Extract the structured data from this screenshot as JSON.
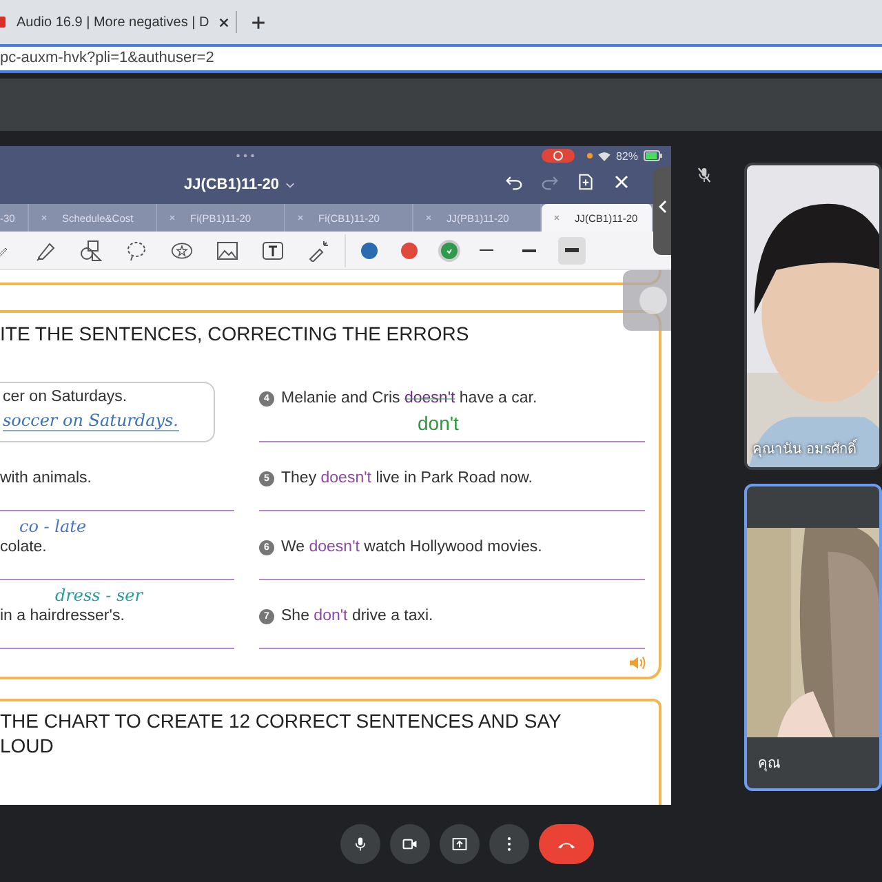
{
  "browser": {
    "tab": {
      "title": "Audio 16.9 | More negatives | D"
    },
    "address": "pc-auxm-hvk?pli=1&authuser=2"
  },
  "shared_screen": {
    "battery": "82%",
    "title": "JJ(CB1)11-20",
    "tabs": [
      {
        "label": "-30",
        "selected": false
      },
      {
        "label": "Schedule&Cost",
        "selected": false
      },
      {
        "label": "Fi(PB1)11-20",
        "selected": false
      },
      {
        "label": "Fi(CB1)11-20",
        "selected": false
      },
      {
        "label": "JJ(PB1)11-20",
        "selected": false
      },
      {
        "label": "JJ(CB1)11-20",
        "selected": true
      }
    ],
    "colors": [
      {
        "color": "#2b6cb0",
        "selected": false
      },
      {
        "color": "#e04a3c",
        "selected": false
      },
      {
        "color": "#2f9a4c",
        "selected": true
      }
    ],
    "strokes": [
      {
        "kind": "thin",
        "selected": false
      },
      {
        "kind": "medium",
        "selected": false
      },
      {
        "kind": "thick",
        "selected": true
      }
    ],
    "heading": "ITE THE SENTENCES, CORRECTING THE ERRORS",
    "left_items": [
      {
        "kind": "example",
        "text": "cer on Saturdays.",
        "answer": "soccer on Saturdays."
      },
      {
        "kind": "item",
        "text": "with animals."
      },
      {
        "kind": "item",
        "text": "colate.",
        "note": "co - late"
      },
      {
        "kind": "item",
        "text": "in a hairdresser's.",
        "note": "dress - ser"
      }
    ],
    "right_items": [
      {
        "number": "4",
        "before": "Melanie and Cris ",
        "error": "doesn't",
        "after": " have a car.",
        "struck": true,
        "answer": "don't"
      },
      {
        "number": "5",
        "before": "They ",
        "error": "doesn't",
        "after": " live in Park Road now.",
        "struck": false
      },
      {
        "number": "6",
        "before": "We ",
        "error": "doesn't",
        "after": " watch Hollywood movies.",
        "struck": false
      },
      {
        "number": "7",
        "before": "She ",
        "error": "don't",
        "after": " drive a taxi.",
        "struck": false
      }
    ],
    "next_heading": [
      "THE CHART TO CREATE 12 CORRECT SENTENCES AND SAY",
      "LOUD"
    ]
  },
  "participants": [
    {
      "name": "คุณานัน อมรศักดิ์",
      "kind": "full",
      "highlighted": false
    },
    {
      "name": "คุณ",
      "kind": "letterboxed",
      "highlighted": true
    }
  ]
}
